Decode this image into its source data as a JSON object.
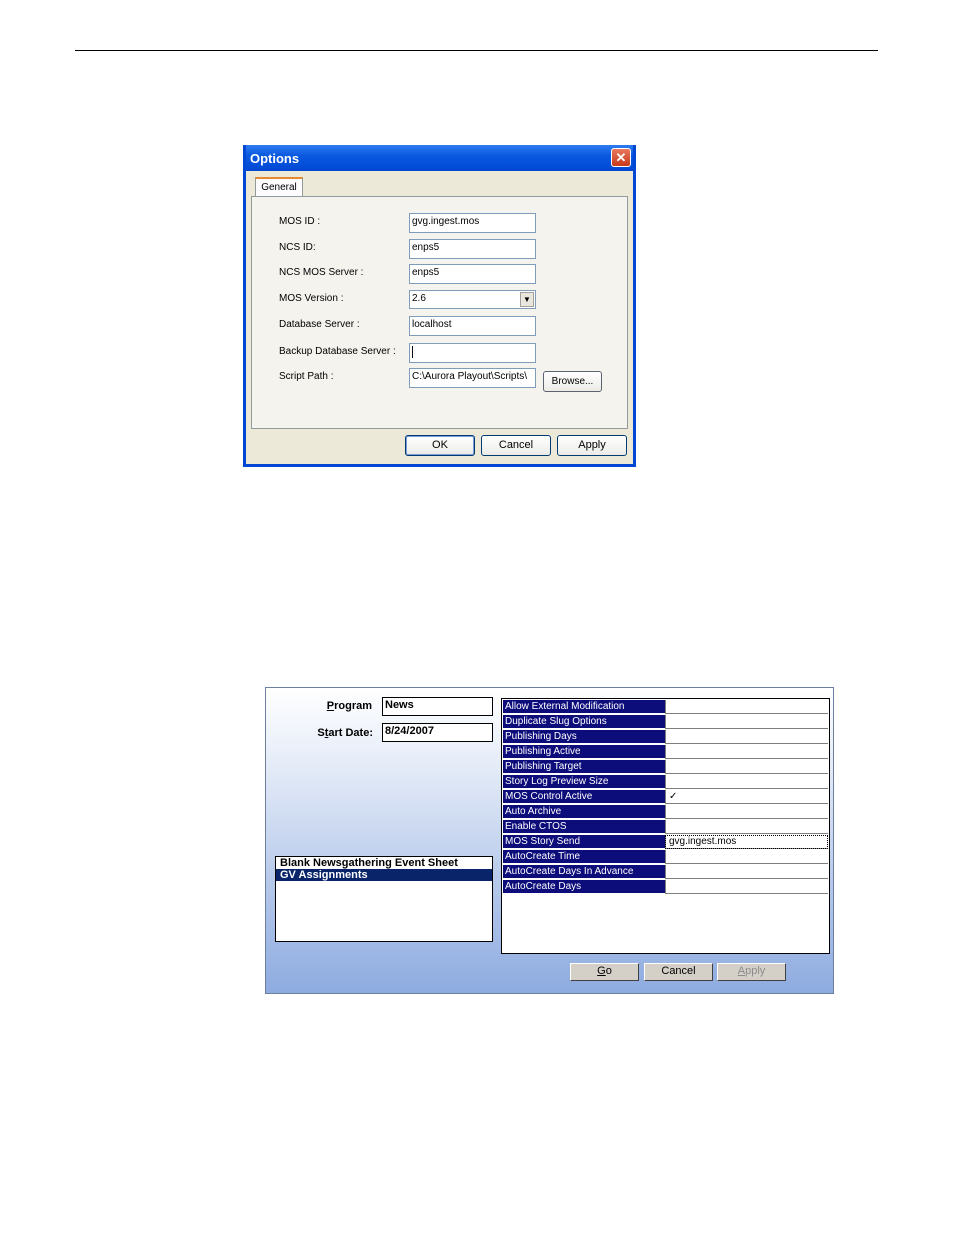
{
  "options_dialog": {
    "title": "Options",
    "close_glyph": "✕",
    "tab_general": "General",
    "fields": [
      {
        "label": "MOS ID :",
        "value": "gvg.ingest.mos"
      },
      {
        "label": "NCS ID:",
        "value": "enps5"
      },
      {
        "label": "NCS MOS Server :",
        "value": "enps5"
      },
      {
        "label": "MOS Version :",
        "value": "2.6"
      },
      {
        "label": "Database Server :",
        "value": "localhost"
      },
      {
        "label": "Backup Database Server :",
        "value": ""
      },
      {
        "label": "Script Path :",
        "value": "C:\\Aurora Playout\\Scripts\\"
      }
    ],
    "mos_version_arrow": "▼",
    "browse_label": "Browse...",
    "ok_label": "OK",
    "cancel_label": "Cancel",
    "apply_label": "Apply"
  },
  "program_panel": {
    "program_label_pre": "",
    "program_label_hotkey": "P",
    "program_label_post": "rogram",
    "program_value": "News",
    "start_label_pre": "S",
    "start_label_hotkey": "t",
    "start_label_post": "art Date:",
    "start_value": "8/24/2007",
    "templates": [
      {
        "label": "Blank Newsgathering Event Sheet",
        "selected": false
      },
      {
        "label": "GV Assignments",
        "selected": true
      }
    ],
    "properties": [
      {
        "key": "Allow External Modification",
        "value": ""
      },
      {
        "key": "Duplicate Slug Options",
        "value": ""
      },
      {
        "key": "Publishing Days",
        "value": ""
      },
      {
        "key": "Publishing Active",
        "value": ""
      },
      {
        "key": "Publishing Target",
        "value": ""
      },
      {
        "key": "Story Log Preview Size",
        "value": ""
      },
      {
        "key": "MOS Control Active",
        "value": "✓"
      },
      {
        "key": "Auto Archive",
        "value": ""
      },
      {
        "key": "Enable CTOS",
        "value": ""
      },
      {
        "key": "MOS Story Send",
        "value": "gvg.ingest.mos"
      },
      {
        "key": "AutoCreate Time",
        "value": ""
      },
      {
        "key": "AutoCreate Days In Advance",
        "value": ""
      },
      {
        "key": "AutoCreate Days",
        "value": ""
      }
    ],
    "go_hotkey": "G",
    "go_rest": "o",
    "cancel_label": "Cancel",
    "apply_hotkey": "A",
    "apply_rest": "pply"
  }
}
